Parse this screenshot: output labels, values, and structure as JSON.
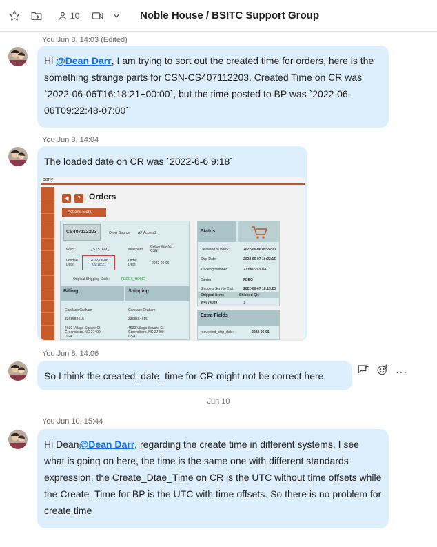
{
  "header": {
    "title": "Noble House / BSITC Support Group",
    "member_count": "10",
    "icons": [
      "star-icon",
      "share-icon",
      "members-icon",
      "video-icon",
      "chevron-down-icon"
    ]
  },
  "messages": [
    {
      "meta": "You Jun 8, 14:03 (Edited)",
      "text_prefix": "Hi ",
      "mention": "@Dean Darr",
      "text": ", I am trying to sort out the created time for orders,  here is the something strange parts for CSN-CS407112203.  Created Time on CR was `2022-06-06T16:18:21+00:00`, but the time posted to BP was `2022-06-06T09:22:48-07:00`"
    },
    {
      "meta": "You Jun 8, 14:04",
      "text": "The loaded date on CR was `2022-6-6 9:18`"
    },
    {
      "meta": "You Jun 8, 14:06",
      "text": "So I think the created_date_time for CR might not be correct here."
    },
    {
      "meta": "You Jun 10, 15:44",
      "text_prefix": "Hi Dean",
      "mention": "@Dean Darr",
      "text": ", regarding the create time in different systems, I see what is going on here, the time is the same one with different standards expression, the Create_Dtae_Time on CR is the UTC without time offsets while the Create_Time for BP is the UTC with time offsets. So there is no problem for create time"
    }
  ],
  "date_separator": "Jun 10",
  "screenshot": {
    "company": "pany",
    "title": "Orders",
    "actions_menu": "Actions Menu",
    "order_id": "CS407112203",
    "order_source_label": "Order Source:",
    "order_source": "APIAccess2",
    "wms_label": "WMS:",
    "wms": "_SYSTEM_",
    "merchant_label": "Merchant:",
    "merchant": "Celigo Wayfair CSN",
    "loaded_date_label": "Loaded Date:",
    "loaded_date": "2022-06-06 09:18:21",
    "order_date_label": "Order Date:",
    "order_date": "2022-06-06",
    "orig_shipping_label": "Original Shipping Code:",
    "orig_shipping": "FEDEX_HOME",
    "billing_label": "Billing",
    "shipping_label": "Shipping",
    "billing_name": "Candace Graham",
    "billing_phone": "3368584616",
    "billing_addr1": "4630 Village Square Ct",
    "billing_addr2": "Greensboro, NC 27409",
    "billing_country": "USA",
    "shipping_name": "Candace Graham",
    "shipping_phone": "3368584616",
    "shipping_addr1": "4630 Village Square Ct",
    "shipping_addr2": "Greensboro, NC 27409",
    "shipping_country": "USA",
    "status_label": "Status",
    "delivered_label": "Delivered to WMS:",
    "delivered": "2022-06-06 09:24:00",
    "ship_date_label": "Ship Date:",
    "ship_date": "2022-06-07 10:22:16",
    "tracking_label": "Tracking Number:",
    "tracking": "273982293064",
    "carrier_label": "Carrier:",
    "carrier": "FDEG",
    "sent_to_cart_label": "Shipping Sent to Cart:",
    "sent_to_cart": "2022-06-07 18:13:20",
    "shipped_items_label": "Shipped Items",
    "shipped_qty_label": "Shipped Qty",
    "item_sku": "W4974039",
    "item_qty": "1",
    "extra_fields_label": "Extra Fields",
    "requested_ship_label": "requested_ship_date:",
    "requested_ship": "2022-06-06"
  },
  "colors": {
    "bubble": "#ddeefc",
    "mention": "#0e71eb",
    "accent_orange": "#c75a2a"
  }
}
